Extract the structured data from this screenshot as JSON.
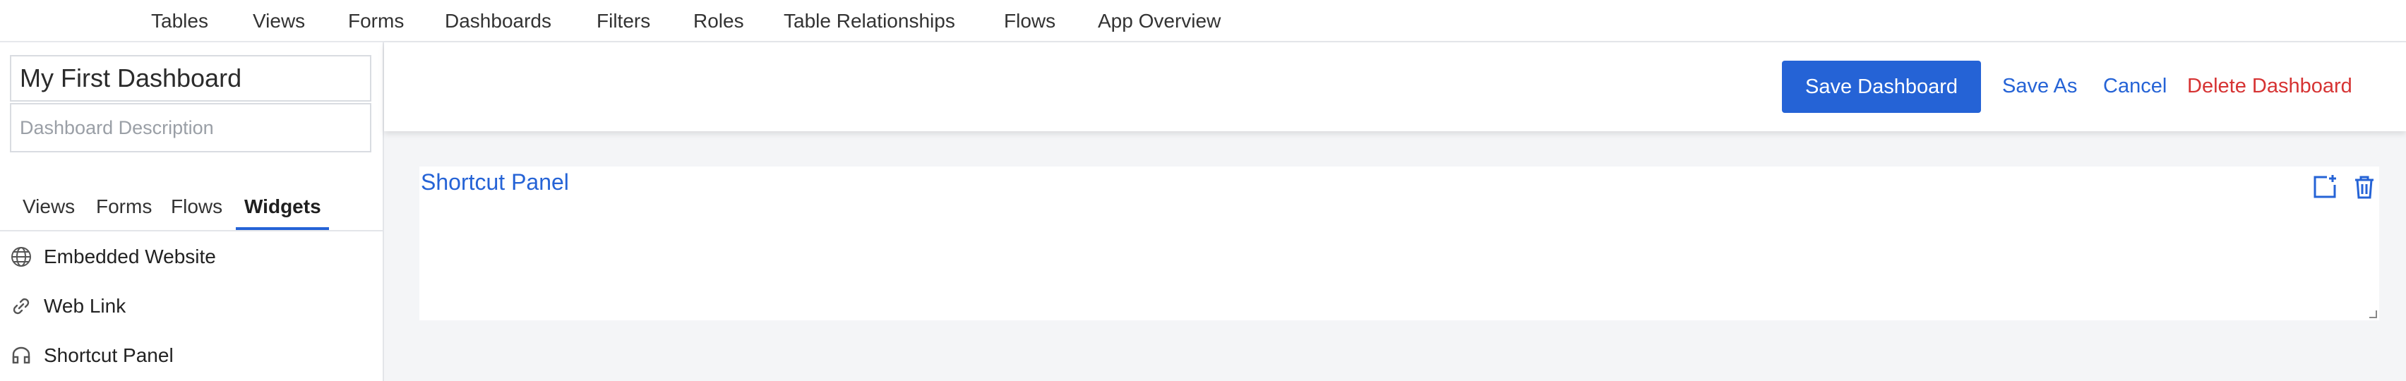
{
  "nav": {
    "items": [
      "Tables",
      "Views",
      "Forms",
      "Dashboards",
      "Filters",
      "Roles",
      "Table Relationships",
      "Flows",
      "App Overview"
    ]
  },
  "sidebar": {
    "dashboard_title": "My First Dashboard",
    "description_placeholder": "Dashboard Description",
    "tabs": [
      "Views",
      "Forms",
      "Flows",
      "Widgets"
    ],
    "active_tab": "Widgets",
    "widgets": [
      {
        "label": "Embedded Website",
        "icon": "globe-icon"
      },
      {
        "label": "Web Link",
        "icon": "link-icon"
      },
      {
        "label": "Shortcut Panel",
        "icon": "shortcut-panel-icon"
      }
    ]
  },
  "actions": {
    "save_label": "Save Dashboard",
    "save_as_label": "Save As",
    "cancel_label": "Cancel",
    "delete_label": "Delete Dashboard"
  },
  "panel": {
    "title": "Shortcut Panel",
    "icons": [
      "add-shortcut-icon",
      "trash-icon",
      "resize-handle-icon"
    ]
  },
  "colors": {
    "accent": "#2563d6",
    "danger": "#d63333",
    "main_background": "#f4f5f7",
    "border": "#d9dce1"
  }
}
